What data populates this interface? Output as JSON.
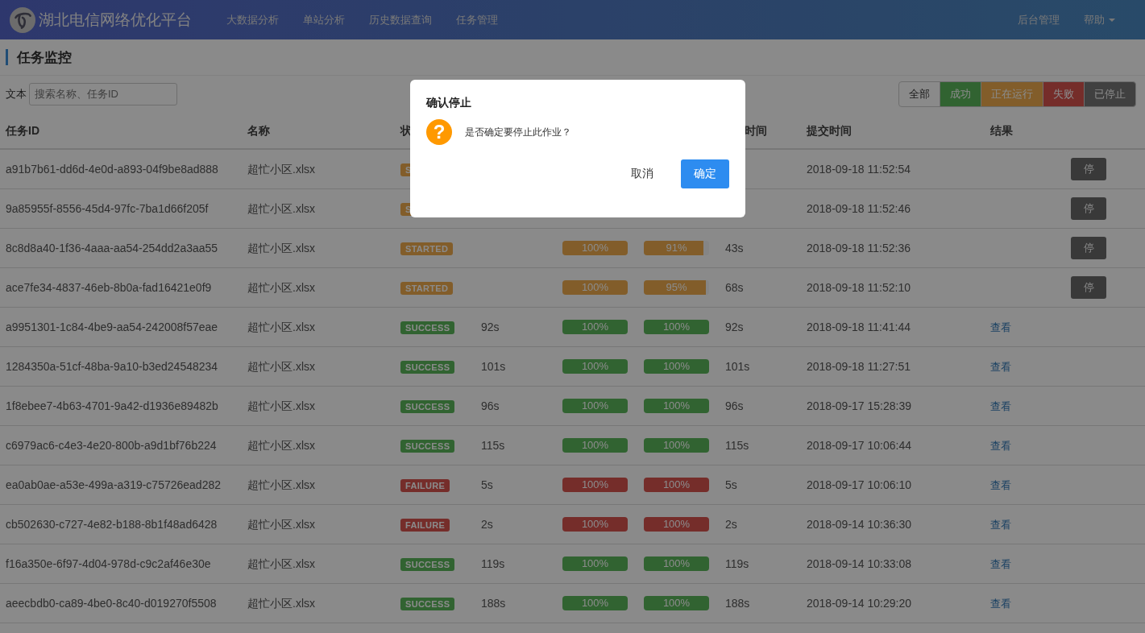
{
  "navbar": {
    "brand": "湖北电信网络优化平台",
    "menu": [
      {
        "label": "大数据分析"
      },
      {
        "label": "单站分析"
      },
      {
        "label": "历史数据查询"
      },
      {
        "label": "任务管理"
      }
    ],
    "right_menu": [
      {
        "label": "后台管理",
        "kind": "link"
      },
      {
        "label": "帮助",
        "kind": "dropdown"
      }
    ]
  },
  "page_title": "任务监控",
  "search": {
    "label": "文本",
    "placeholder": "搜索名称、任务ID"
  },
  "filters": [
    {
      "label": "全部",
      "kind": "all"
    },
    {
      "label": "成功",
      "kind": "success"
    },
    {
      "label": "正在运行",
      "kind": "running"
    },
    {
      "label": "失败",
      "kind": "failure"
    },
    {
      "label": "已停止",
      "kind": "stopped"
    }
  ],
  "table": {
    "columns": [
      "任务ID",
      "名称",
      "状",
      "时间",
      "提交时间",
      "结果"
    ],
    "rows": [
      {
        "id": "a91b7b61-dd6d-4e0d-a893-04f9be8ad888",
        "name": "超忙小区.xlsx",
        "kind": "started",
        "status": "S",
        "submitted": "2018-09-18 11:52:54",
        "action": {
          "kind": "button",
          "label": "停"
        }
      },
      {
        "id": "9a85955f-8556-45d4-97fc-7ba1d66f205f",
        "name": "超忙小区.xlsx",
        "kind": "started",
        "status": "S",
        "submitted": "2018-09-18 11:52:46",
        "action": {
          "kind": "button",
          "label": "停"
        }
      },
      {
        "id": "8c8d8a40-1f36-4aaa-aa54-254dd2a3aa55",
        "name": "超忙小区.xlsx",
        "kind": "started",
        "status": "STARTED",
        "progress_1": {
          "level": 1,
          "reading": "100%"
        },
        "progress_2": {
          "level": 0.91,
          "reading": "91%"
        },
        "elapsed": "43s",
        "submitted": "2018-09-18 11:52:36",
        "action": {
          "kind": "button",
          "label": "停"
        }
      },
      {
        "id": "ace7fe34-4837-46eb-8b0a-fad16421e0f9",
        "name": "超忙小区.xlsx",
        "kind": "started",
        "status": "STARTED",
        "progress_1": {
          "level": 1,
          "reading": "100%"
        },
        "progress_2": {
          "level": 0.95,
          "reading": "95%"
        },
        "elapsed": "68s",
        "submitted": "2018-09-18 11:52:10",
        "action": {
          "kind": "button",
          "label": "停"
        }
      },
      {
        "id": "a9951301-1c84-4be9-aa54-242008f57eae",
        "name": "超忙小区.xlsx",
        "kind": "success",
        "status": "SUCCESS",
        "duration": "92s",
        "progress_1": {
          "level": 1,
          "reading": "100%"
        },
        "progress_2": {
          "level": 1,
          "reading": "100%"
        },
        "elapsed": "92s",
        "submitted": "2018-09-18 11:41:44",
        "action": {
          "kind": "link",
          "label": "查看"
        }
      },
      {
        "id": "1284350a-51cf-48ba-9a10-b3ed24548234",
        "name": "超忙小区.xlsx",
        "kind": "success",
        "status": "SUCCESS",
        "duration": "101s",
        "progress_1": {
          "level": 1,
          "reading": "100%"
        },
        "progress_2": {
          "level": 1,
          "reading": "100%"
        },
        "elapsed": "101s",
        "submitted": "2018-09-18 11:27:51",
        "action": {
          "kind": "link",
          "label": "查看"
        }
      },
      {
        "id": "1f8ebee7-4b63-4701-9a42-d1936e89482b",
        "name": "超忙小区.xlsx",
        "kind": "success",
        "status": "SUCCESS",
        "duration": "96s",
        "progress_1": {
          "level": 1,
          "reading": "100%"
        },
        "progress_2": {
          "level": 1,
          "reading": "100%"
        },
        "elapsed": "96s",
        "submitted": "2018-09-17 15:28:39",
        "action": {
          "kind": "link",
          "label": "查看"
        }
      },
      {
        "id": "c6979ac6-c4e3-4e20-800b-a9d1bf76b224",
        "name": "超忙小区.xlsx",
        "kind": "success",
        "status": "SUCCESS",
        "duration": "115s",
        "progress_1": {
          "level": 1,
          "reading": "100%"
        },
        "progress_2": {
          "level": 1,
          "reading": "100%"
        },
        "elapsed": "115s",
        "submitted": "2018-09-17 10:06:44",
        "action": {
          "kind": "link",
          "label": "查看"
        }
      },
      {
        "id": "ea0ab0ae-a53e-499a-a319-c75726ead282",
        "name": "超忙小区.xlsx",
        "kind": "failure",
        "status": "FAILURE",
        "duration": "5s",
        "progress_1": {
          "level": 1,
          "reading": "100%"
        },
        "progress_2": {
          "level": 1,
          "reading": "100%"
        },
        "elapsed": "5s",
        "submitted": "2018-09-17 10:06:10",
        "action": {
          "kind": "link",
          "label": "查看"
        }
      },
      {
        "id": "cb502630-c727-4e82-b188-8b1f48ad6428",
        "name": "超忙小区.xlsx",
        "kind": "failure",
        "status": "FAILURE",
        "duration": "2s",
        "progress_1": {
          "level": 1,
          "reading": "100%"
        },
        "progress_2": {
          "level": 1,
          "reading": "100%"
        },
        "elapsed": "2s",
        "submitted": "2018-09-14 10:36:30",
        "action": {
          "kind": "link",
          "label": "查看"
        }
      },
      {
        "id": "f16a350e-6f97-4d04-978d-c9c2af46e30e",
        "name": "超忙小区.xlsx",
        "kind": "success",
        "status": "SUCCESS",
        "duration": "119s",
        "progress_1": {
          "level": 1,
          "reading": "100%"
        },
        "progress_2": {
          "level": 1,
          "reading": "100%"
        },
        "elapsed": "119s",
        "submitted": "2018-09-14 10:33:08",
        "action": {
          "kind": "link",
          "label": "查看"
        }
      },
      {
        "id": "aeecbdb0-ca89-4be0-8c40-d019270f5508",
        "name": "超忙小区.xlsx",
        "kind": "success",
        "status": "SUCCESS",
        "duration": "188s",
        "progress_1": {
          "level": 1,
          "reading": "100%"
        },
        "progress_2": {
          "level": 1,
          "reading": "100%"
        },
        "elapsed": "188s",
        "submitted": "2018-09-14 10:29:20",
        "action": {
          "kind": "link",
          "label": "查看"
        }
      }
    ]
  },
  "dialog": {
    "title": "确认停止",
    "icon": "?",
    "message": "是否确定要停止此作业？",
    "buttons": [
      {
        "label": "取消",
        "kind": "text"
      },
      {
        "label": "确定",
        "kind": "primary"
      }
    ]
  }
}
